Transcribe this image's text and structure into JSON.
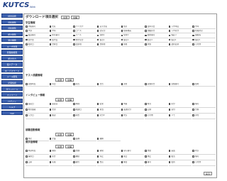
{
  "header": {
    "logo": "KUTCS",
    "logo_sub": "Web"
  },
  "sidebar": [
    "検索画面",
    "資料閲覧",
    "資料閲覧",
    "統計閲覧",
    "受付業務",
    "ユーザ管理",
    "管理者権限",
    "統計出力",
    "個人データ",
    "ID・パスワード",
    "メール閲覧",
    "記事情報",
    "ダウンロード",
    "マイページ",
    "ログイン",
    "ヘルプ",
    "TOP"
  ],
  "page": {
    "title": "ダウンロード項目選択",
    "btn_all": "全選",
    "btn_clear": "全解",
    "btn_bottom": "戻る"
  },
  "sections": [
    {
      "label": "学生情報",
      "items": [
        "学籍番号",
        "氏名",
        "フリガナ",
        "英字氏名",
        "性別",
        "生年月日",
        "入学年度",
        "学年",
        "学部",
        "学科",
        "コース",
        "研究室",
        "指導教員",
        "国籍区分",
        "入学区分",
        "在籍状況",
        "電話番号",
        "携帯番号",
        "メール",
        "住所1",
        "住所2",
        "郵便番号",
        "保証人",
        "連絡先",
        "奨学金",
        "留学生",
        "休学区分",
        "備考1",
        "備考2",
        "備考3",
        "備考4",
        "備考5",
        "更新日",
        "登録日",
        "更新者",
        "登録者",
        "資格",
        "状態",
        "選択必須",
        "その他"
      ]
    },
    {
      "label": "テスト成績情報",
      "items": [
        "受験年度",
        "科目",
        "得点",
        "合否",
        "評価",
        "受験区分",
        "受験番号",
        "会場"
      ]
    },
    {
      "label": "インタビュー情報",
      "items": [
        "面接日",
        "面接官",
        "時間",
        "結果",
        "内容",
        "所見",
        "区分",
        "備考",
        "希望進路",
        "志望",
        "相談日",
        "担当",
        "面談区分",
        "記録",
        "受付",
        "分類",
        "入力日",
        "確認",
        "報告",
        "区分2",
        "状況",
        "その他",
        "メモ",
        "添付"
      ]
    },
    {
      "label": "就職活動情報",
      "items": [
        "内定",
        "企業",
        "業種",
        "職種"
      ]
    },
    {
      "label": "奨学金情報",
      "items": [
        "申請年度",
        "種別",
        "金額",
        "期間",
        "貸与番号",
        "支給",
        "返還",
        "状況",
        "採用日",
        "区分",
        "継続",
        "停止",
        "廃止",
        "休止",
        "復活",
        "備考",
        "口座",
        "名義",
        "銀行",
        "支店",
        "種目",
        "番号",
        "更新",
        "その他"
      ]
    }
  ]
}
